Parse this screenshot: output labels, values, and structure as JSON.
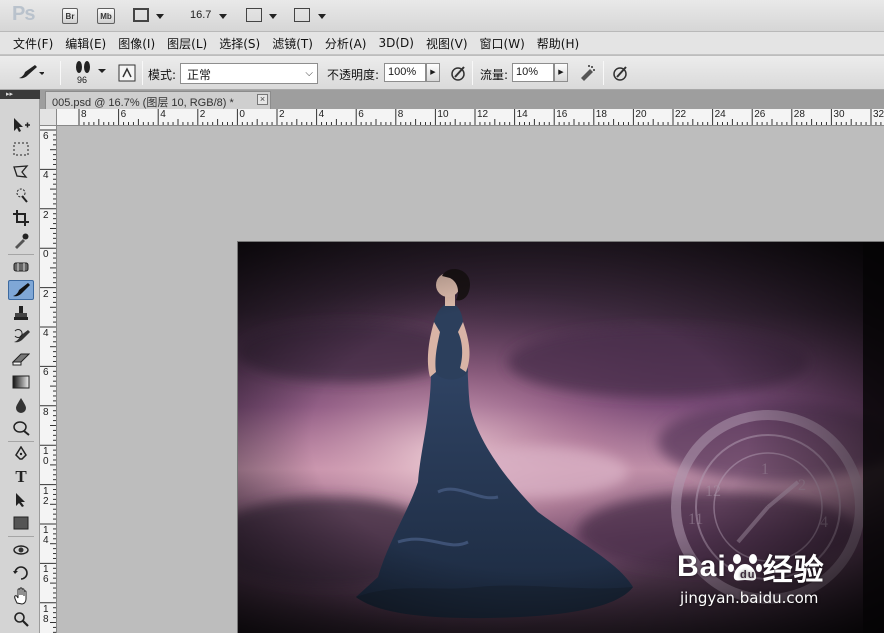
{
  "app": {
    "logo": "Ps",
    "bridge_label": "Br",
    "minibridge_label": "Mb",
    "zoom": "16.7"
  },
  "menu": [
    "文件(F)",
    "编辑(E)",
    "图像(I)",
    "图层(L)",
    "选择(S)",
    "滤镜(T)",
    "分析(A)",
    "3D(D)",
    "视图(V)",
    "窗口(W)",
    "帮助(H)"
  ],
  "options": {
    "brush_size": "96",
    "mode_label": "模式:",
    "mode_value": "正常",
    "opacity_label": "不透明度:",
    "opacity_value": "100%",
    "flow_label": "流量:",
    "flow_value": "10%"
  },
  "document": {
    "tab_title": "005.psd @ 16.7% (图层 10, RGB/8) *",
    "close_label": "×"
  },
  "rulers": {
    "horizontal": [
      "8",
      "6",
      "4",
      "2",
      "0",
      "2",
      "4",
      "6",
      "8",
      "10",
      "12",
      "14",
      "16",
      "18",
      "20",
      "22",
      "24",
      "26",
      "28",
      "30",
      "32"
    ],
    "vertical": [
      "6",
      "4",
      "2",
      "0",
      "2",
      "4",
      "6",
      "8",
      "1\n0",
      "1\n2",
      "1\n4",
      "1\n6",
      "1\n8"
    ]
  },
  "watermark": {
    "logo_left": "Bai",
    "logo_right": "经验",
    "url": "jingyan.baidu.com"
  },
  "colors": {
    "active_tool": "#7fa7d6",
    "sky_purple": "#6a3c6e",
    "dress_blue": "#2c3f5c"
  }
}
